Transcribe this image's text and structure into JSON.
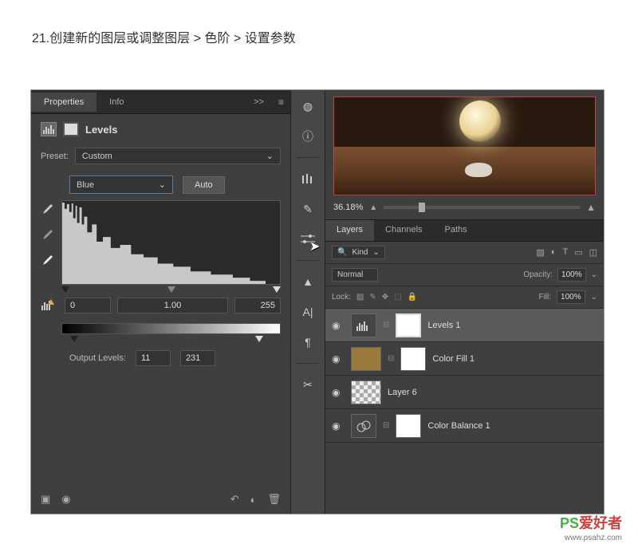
{
  "tutorial": {
    "step": "21.创建新的图层或调整图层 > 色阶 > 设置参数"
  },
  "properties": {
    "tab_properties": "Properties",
    "tab_info": "Info",
    "expand": ">>",
    "title": "Levels",
    "preset_label": "Preset:",
    "preset_value": "Custom",
    "channel": "Blue",
    "auto": "Auto",
    "input_black": "0",
    "input_gamma": "1.00",
    "input_white": "255",
    "output_label": "Output Levels:",
    "output_black": "11",
    "output_white": "231"
  },
  "navigator": {
    "zoom": "36.18%"
  },
  "layers": {
    "tab_layers": "Layers",
    "tab_channels": "Channels",
    "tab_paths": "Paths",
    "kind": "Kind",
    "blend": "Normal",
    "opacity_label": "Opacity:",
    "opacity": "100%",
    "lock_label": "Lock:",
    "fill_label": "Fill:",
    "fill": "100%",
    "items": [
      {
        "name": "Levels 1"
      },
      {
        "name": "Color Fill 1"
      },
      {
        "name": "Layer 6"
      },
      {
        "name": "Color Balance 1"
      }
    ]
  },
  "watermark": {
    "brand_a": "PS",
    "brand_b": "爱好者",
    "url": "www.psahz.com"
  },
  "icons": {
    "search": "🔍",
    "dd": "⌄"
  }
}
